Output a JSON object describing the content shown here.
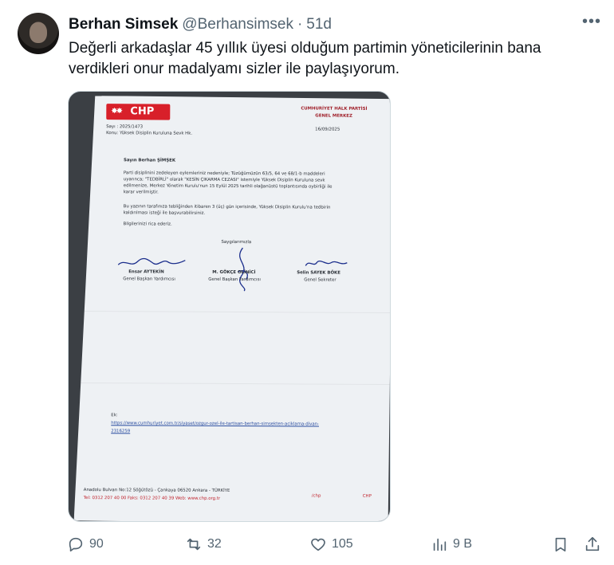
{
  "post": {
    "author_name": "Berhan Simsek",
    "handle": "@Berhansimsek",
    "separator": "·",
    "time": "51d",
    "text": "Değerli arkadaşlar 45 yıllık üyesi olduğum partimin  yöneticilerinin bana verdikleri onur madalyamı sizler ile paylaşıyorum."
  },
  "document": {
    "logo": "CHP",
    "org_line1": "CUMHURİYET HALK PARTİSİ",
    "org_line2": "GENEL MERKEZ",
    "sayi": "Sayı : 2025/1473",
    "konu": "Konu: Yüksek Disiplin Kuruluna Sevk Hk.",
    "date": "16/09/2025",
    "salutation": "Sayın Berhan ŞİMŞEK",
    "para1_l1": "Parti disiplinini zedeleyen eylemleriniz nedeniyle; Tüzüğümüzün 63/5, 64 ve 68/1-b maddeleri",
    "para1_l2": "uyarınca; \"TEDBİRLİ\" olarak \"KESİN ÇIKARMA CEZASI\" istemiyle Yüksek Disiplin Kuruluna sevk",
    "para1_l3": "edilmenize, Merkez Yönetim Kurulu'nun 15 Eylül 2025 tarihli olağanüstü toplantısında oybirliği ile",
    "para1_l4": "karar verilmiştir.",
    "para2_l1": "Bu yazının tarafınıza tebliğinden itibaren 3 (üç) gün içerisinde, Yüksek Disiplin Kurulu'na tedbirin",
    "para2_l2": "kaldırılması isteği ile başvurabilirsiniz.",
    "para3": "Bilgilerinizi rica ederiz.",
    "closing": "Saygılarımızla",
    "sig1_name": "Ensar AYTEKİN",
    "sig1_title": "Genel Başkan Yardımcısı",
    "sig2_name": "M. GÖKÇE OLİNİCİ",
    "sig2_title": "Genel Başkan Yardımcısı",
    "sig3_name": "Selin SAYEK BÖKE",
    "sig3_title": "Genel Sekreter",
    "ek_label": "Ek:",
    "ek_link_l1": "https://www.cumhuriyet.com.tr/siyaset/ozgur-ozel-ile-tartisan-berhan-simsekten-aciklama-divan-",
    "ek_link_l2": "2316259",
    "footer_address": "Anadolu Bulvarı No:12 Söğütözü - Çankaya 06520 Ankara - TÜRKİYE",
    "footer_contact": "Tel: 0312 207 40 00   Faks: 0312 207 40 39   Web: www.chp.org.tr",
    "footer_social": "/chp",
    "footer_chp": "CHP"
  },
  "actions": {
    "replies": "90",
    "reposts": "32",
    "likes": "105",
    "views": "9 B"
  },
  "icons": {
    "more": "more-icon",
    "reply": "reply-icon",
    "repost": "repost-icon",
    "like": "like-icon",
    "views": "views-icon",
    "bookmark": "bookmark-icon",
    "share": "share-icon"
  },
  "colors": {
    "text": "#0f1419",
    "secondary": "#536471",
    "chp_red": "#d8202a"
  }
}
